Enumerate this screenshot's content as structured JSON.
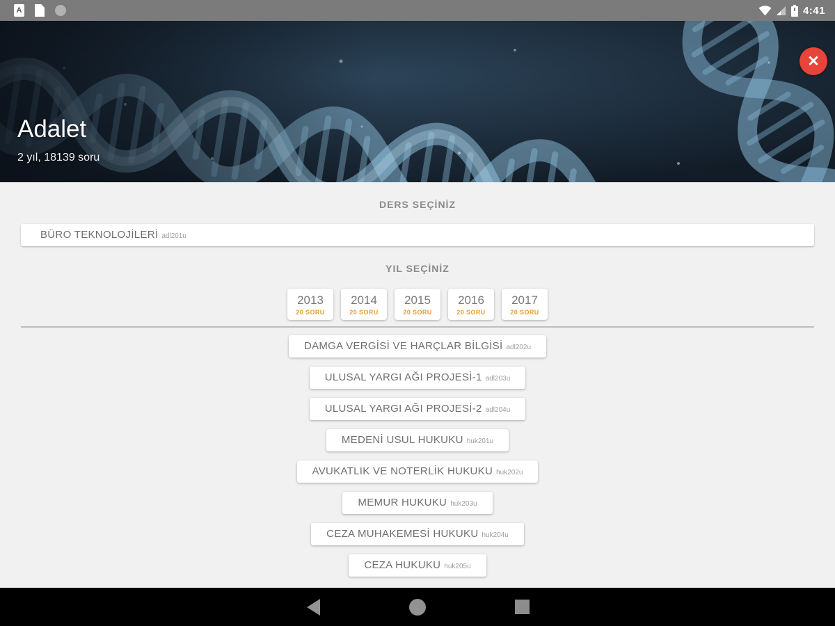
{
  "status_bar": {
    "time": "4:41",
    "a_badge_glyph": "A",
    "left_icons": [
      "a-badge-icon",
      "document-icon",
      "circle-icon"
    ],
    "right_icons": [
      "wifi-icon",
      "signal-icon",
      "battery-icon"
    ]
  },
  "header": {
    "title": "Adalet",
    "subtitle": "2 yıl, 18139 soru",
    "close_glyph": "✕"
  },
  "sections": {
    "course_label": "DERS SEÇİNİZ",
    "year_label": "YIL SEÇİNİZ"
  },
  "selected_course": {
    "name": "BÜRO TEKNOLOJİLERİ",
    "code": "adl201u"
  },
  "years": [
    {
      "year": "2013",
      "count": "20 SORU"
    },
    {
      "year": "2014",
      "count": "20 SORU"
    },
    {
      "year": "2015",
      "count": "20 SORU"
    },
    {
      "year": "2016",
      "count": "20 SORU"
    },
    {
      "year": "2017",
      "count": "20 SORU"
    }
  ],
  "courses": [
    {
      "name": "DAMGA VERGİSİ VE HARÇLAR BİLGİSİ",
      "code": "adl202u"
    },
    {
      "name": "ULUSAL YARGI AĞI PROJESİ-1",
      "code": "adl203u"
    },
    {
      "name": "ULUSAL YARGI AĞI PROJESİ-2",
      "code": "adl204u"
    },
    {
      "name": "MEDENİ USUL HUKUKU",
      "code": "huk201u"
    },
    {
      "name": "AVUKATLIK VE NOTERLİK HUKUKU",
      "code": "huk202u"
    },
    {
      "name": "MEMUR HUKUKU",
      "code": "huk203u"
    },
    {
      "name": "CEZA MUHAKEMESİ HUKUKU",
      "code": "huk204u"
    },
    {
      "name": "CEZA HUKUKU",
      "code": "huk205u"
    }
  ],
  "nav_bar": {
    "icons": [
      "back-icon",
      "home-icon",
      "recents-icon"
    ]
  },
  "colors": {
    "close_red": "#e8443a",
    "accent_orange": "#e79b3c",
    "statusbar_gray": "#7b7b7b",
    "hero_navy": "#16222e",
    "content_bg": "#f1f1f2"
  }
}
